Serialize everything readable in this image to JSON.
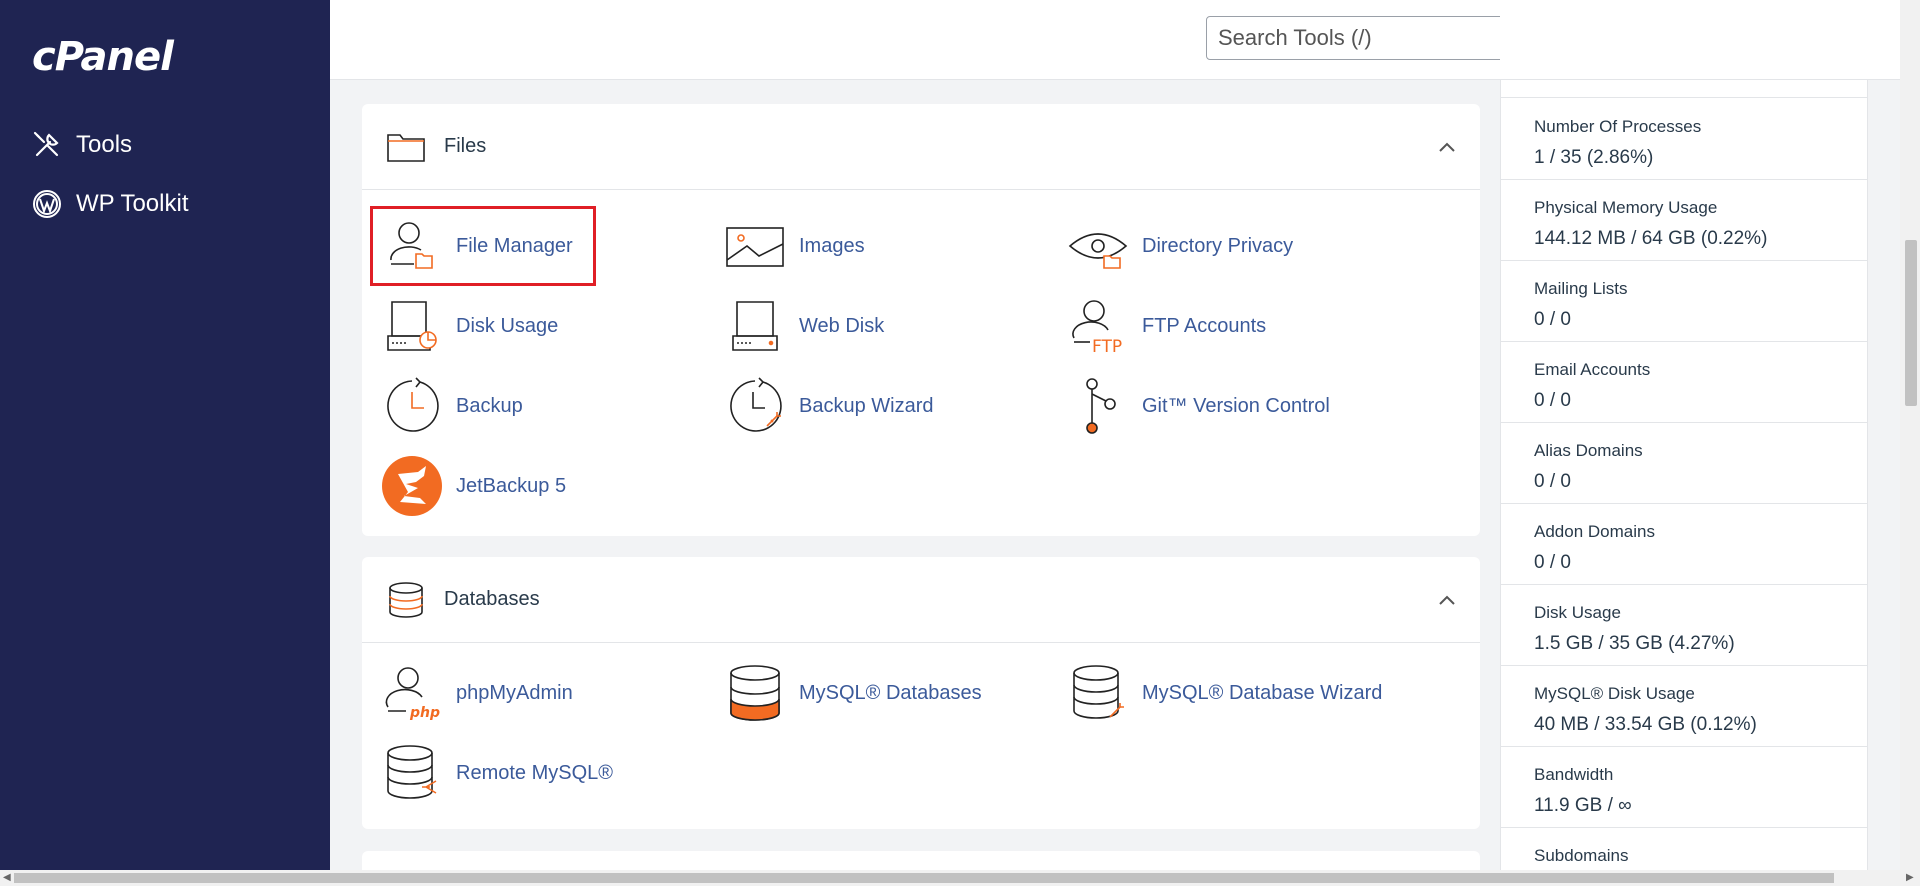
{
  "brand": {
    "logo_text": "cPanel"
  },
  "sidebar": {
    "items": [
      {
        "label": "Tools",
        "icon": "tools-icon"
      },
      {
        "label": "WP Toolkit",
        "icon": "wordpress-icon"
      }
    ]
  },
  "header": {
    "search_placeholder": "Search Tools (/)",
    "icons": [
      "search-icon",
      "bell-icon",
      "user-icon"
    ]
  },
  "files": {
    "title": "Files",
    "tools": [
      {
        "label": "File Manager",
        "icon": "file-manager-icon"
      },
      {
        "label": "Images",
        "icon": "image-icon"
      },
      {
        "label": "Directory Privacy",
        "icon": "eye-folder-icon"
      },
      {
        "label": "Disk Usage",
        "icon": "disk-usage-icon"
      },
      {
        "label": "Web Disk",
        "icon": "web-disk-icon"
      },
      {
        "label": "FTP Accounts",
        "icon": "ftp-user-icon"
      },
      {
        "label": "Backup",
        "icon": "backup-clock-icon"
      },
      {
        "label": "Backup Wizard",
        "icon": "backup-wizard-icon"
      },
      {
        "label": "Git™ Version Control",
        "icon": "git-branch-icon"
      },
      {
        "label": "JetBackup 5",
        "icon": "jetbackup-icon"
      }
    ]
  },
  "databases": {
    "title": "Databases",
    "tools": [
      {
        "label": "phpMyAdmin",
        "icon": "phpmyadmin-icon"
      },
      {
        "label": "MySQL® Databases",
        "icon": "mysql-database-icon"
      },
      {
        "label": "MySQL® Database Wizard",
        "icon": "mysql-wizard-icon"
      },
      {
        "label": "Remote MySQL®",
        "icon": "remote-mysql-icon"
      }
    ]
  },
  "stats": [
    {
      "name": "Number Of Processes",
      "value": "1 / 35   (2.86%)"
    },
    {
      "name": "Physical Memory Usage",
      "value": "144.12 MB / 64 GB   (0.22%)"
    },
    {
      "name": "Mailing Lists",
      "value": "0 / 0"
    },
    {
      "name": "Email Accounts",
      "value": "0 / 0"
    },
    {
      "name": "Alias Domains",
      "value": "0 / 0"
    },
    {
      "name": "Addon Domains",
      "value": "0 / 0"
    },
    {
      "name": "Disk Usage",
      "value": "1.5 GB / 35 GB   (4.27%)"
    },
    {
      "name": "MySQL® Disk Usage",
      "value": "40 MB / 33.54 GB   (0.12%)"
    },
    {
      "name": "Bandwidth",
      "value": "11.9 GB / ∞"
    },
    {
      "name": "Subdomains",
      "value": ""
    }
  ],
  "colors": {
    "sidebar": "#1f2452",
    "link": "#3b5a9a",
    "accent": "#f26b22",
    "highlight": "#e01f26"
  }
}
